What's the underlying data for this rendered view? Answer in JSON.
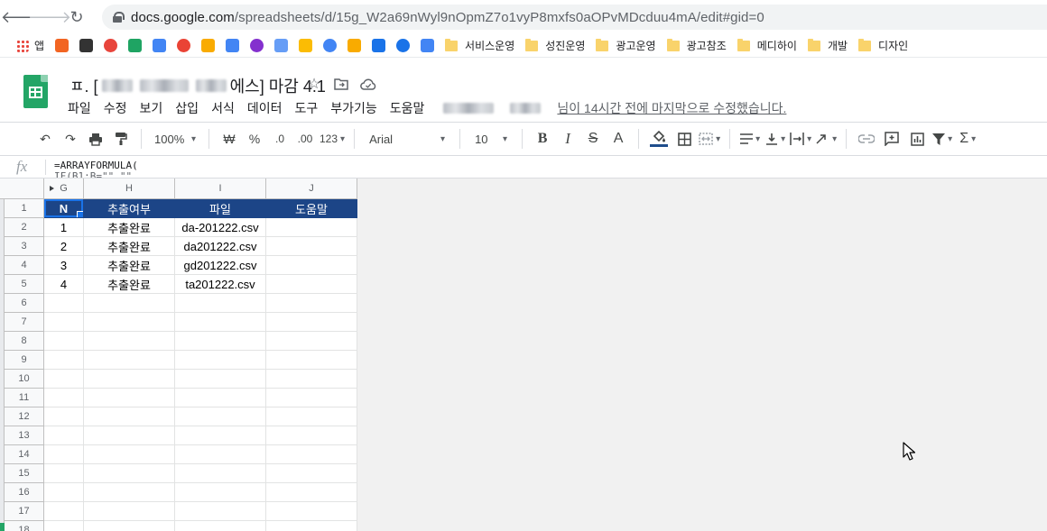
{
  "browser": {
    "url_host": "docs.google.com",
    "url_path": "/spreadsheets/d/15g_W2a69nWyl9nOpmZ7o1vyP8mxfs0aOPvMDcduu4mA/edit#gid=0",
    "bookmarks": [
      {
        "label": "앱",
        "icon": "apps-grid-icon"
      },
      {
        "label": "",
        "icon": "rss-icon",
        "color": "#f26522"
      },
      {
        "label": "",
        "icon": "eyes-icon",
        "color": "#333333"
      },
      {
        "label": "",
        "icon": "sparkle-icon",
        "color": "#e8453c"
      },
      {
        "label": "",
        "icon": "google-drive-icon",
        "color": "#1fa463"
      },
      {
        "label": "",
        "icon": "ads-icon",
        "color": "#4285f4"
      },
      {
        "label": "",
        "icon": "gmail-icon",
        "color": "#ea4335"
      },
      {
        "label": "",
        "icon": "analytics-icon",
        "color": "#f9ab00"
      },
      {
        "label": "",
        "icon": "diamond-icon",
        "color": "#4285f4"
      },
      {
        "label": "",
        "icon": "tag-manager-icon",
        "color": "#8430ce"
      },
      {
        "label": "",
        "icon": "data-studio-icon",
        "color": "#669df6"
      },
      {
        "label": "",
        "icon": "optimize-icon",
        "color": "#fbbc04"
      },
      {
        "label": "",
        "icon": "ads-icon-2",
        "color": "#4285f4"
      },
      {
        "label": "",
        "icon": "chrome-icon",
        "color": "#f9ab00"
      },
      {
        "label": "",
        "icon": "gear-icon",
        "color": "#1a73e8"
      },
      {
        "label": "",
        "icon": "diamond-icon-2",
        "color": "#1a73e8"
      },
      {
        "label": "",
        "icon": "board-icon",
        "color": "#4285f4"
      },
      {
        "label": "서비스운영",
        "icon": "folder-icon"
      },
      {
        "label": "성진운영",
        "icon": "folder-icon"
      },
      {
        "label": "광고운영",
        "icon": "folder-icon"
      },
      {
        "label": "광고참조",
        "icon": "folder-icon"
      },
      {
        "label": "메디하이",
        "icon": "folder-icon"
      },
      {
        "label": "개발",
        "icon": "folder-icon"
      },
      {
        "label": "디자인",
        "icon": "folder-icon"
      }
    ]
  },
  "doc": {
    "title_prefix": "ㅍ. [",
    "title_suffix": "에스] 마감 4.1",
    "menu": [
      "파일",
      "수정",
      "보기",
      "삽입",
      "서식",
      "데이터",
      "도구",
      "부가기능",
      "도움말"
    ],
    "last_edit": "님이 14시간 전에 마지막으로 수정했습니다."
  },
  "toolbar": {
    "zoom": "100%",
    "currency": "₩",
    "percent": "%",
    "dec_decrease": ".0",
    "dec_increase": ".00",
    "number_format": "123",
    "font": "Arial",
    "font_size": "10",
    "bold": "B",
    "italic": "I",
    "strike": "S",
    "text_color": "A",
    "sum": "Σ"
  },
  "formula": {
    "line1": "=ARRAYFORMULA(",
    "line2": "IF(B1:B=\"\",\"\""
  },
  "grid": {
    "columns": [
      "G",
      "H",
      "I",
      "J"
    ],
    "header_row": [
      "N",
      "추출여부",
      "파일",
      "도움말"
    ],
    "rows": [
      [
        "1",
        "추출완료",
        "da-201222.csv",
        ""
      ],
      [
        "2",
        "추출완료",
        "da201222.csv",
        ""
      ],
      [
        "3",
        "추출완료",
        "gd201222.csv",
        ""
      ],
      [
        "4",
        "추출완료",
        "ta201222.csv",
        ""
      ]
    ],
    "row_numbers": [
      "1",
      "2",
      "3",
      "4",
      "5",
      "6",
      "7",
      "8",
      "9",
      "10",
      "11",
      "12",
      "13",
      "14",
      "15",
      "16",
      "17",
      "18"
    ],
    "header_color": "#1c4587"
  }
}
